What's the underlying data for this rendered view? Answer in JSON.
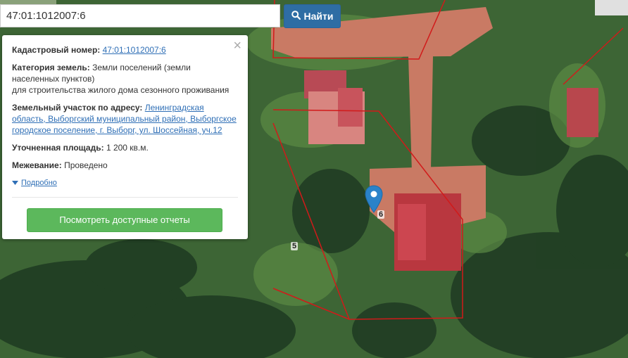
{
  "search": {
    "value": "47:01:1012007:6"
  },
  "find_button": {
    "label": "Найти"
  },
  "popup": {
    "close": "×",
    "cadastral_label": "Кадастровый номер:",
    "cadastral_value": "47:01:1012007:6",
    "category_label": "Категория земель:",
    "category_value": "Земли поселений (земли населенных пунктов)",
    "category_purpose": "для строительства жилого дома сезонного проживания",
    "address_label": "Земельный участок по адресу:",
    "address_value": "Ленинградская область, Выборгский муниципальный район, Выборгское городское поселение, г. Выборг, ул. Шоссейная, уч.12",
    "area_label": "Уточненная площадь:",
    "area_value": "1 200 кв.м.",
    "survey_label": "Межевание:",
    "survey_value": "Проведено",
    "more_link": "Подробно",
    "report_button": "Посмотреть доступные отчеты"
  },
  "map": {
    "plot_labels": [
      "6",
      "5"
    ],
    "border_color": "#d11a1a",
    "marker_color": "#2a82c9"
  }
}
